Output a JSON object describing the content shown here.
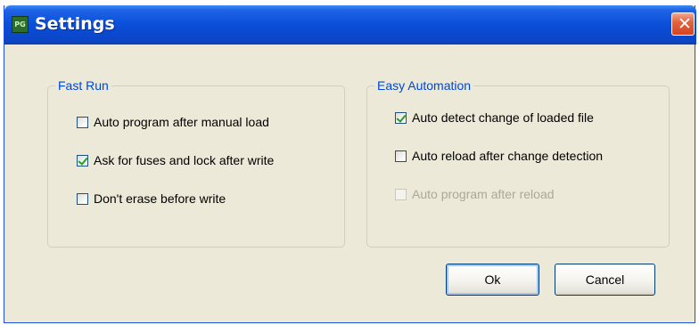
{
  "window": {
    "title": "Settings",
    "app_icon_text": "PG",
    "close_glyph": "✕"
  },
  "fast_run": {
    "legend": "Fast Run",
    "options": [
      {
        "label": "Auto program after manual load",
        "checked": false,
        "enabled": true
      },
      {
        "label": "Ask for fuses and lock after write",
        "checked": true,
        "enabled": true
      },
      {
        "label": "Don't erase before write",
        "checked": false,
        "enabled": true
      }
    ]
  },
  "easy_automation": {
    "legend": "Easy Automation",
    "options": [
      {
        "label": "Auto detect change of loaded file",
        "checked": true,
        "enabled": true
      },
      {
        "label": "Auto reload after change detection",
        "checked": false,
        "enabled": true
      },
      {
        "label": "Auto program after reload",
        "checked": false,
        "enabled": false
      }
    ]
  },
  "buttons": {
    "ok_label": "Ok",
    "cancel_label": "Cancel"
  },
  "colors": {
    "titlebar": "#0a49d0",
    "dialog_bg": "#ece9d8",
    "legend_text": "#0046d5",
    "check_mark": "#21a121",
    "disabled_text": "#aca899"
  },
  "icons": {
    "app": "pg-app-icon",
    "close": "close-icon",
    "check": "check-mark-icon"
  }
}
